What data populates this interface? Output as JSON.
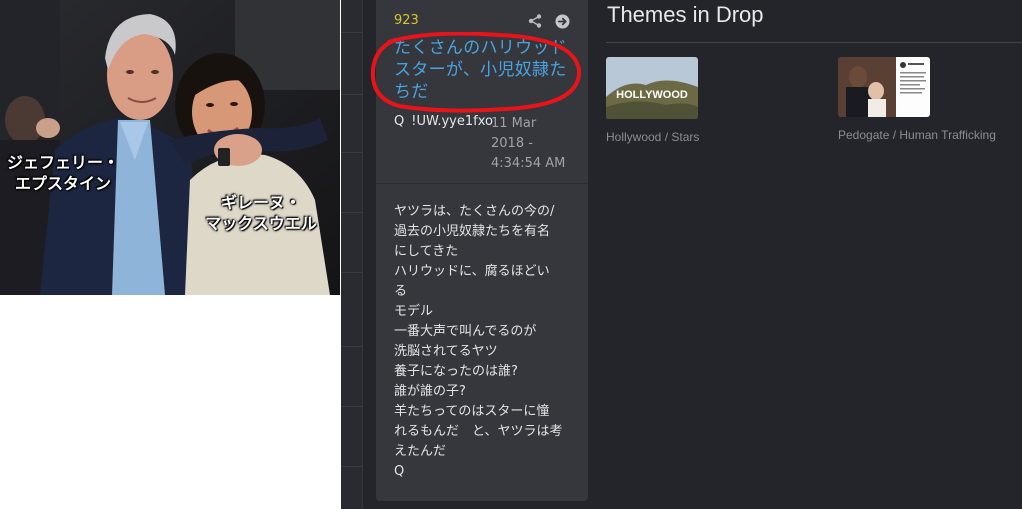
{
  "photo": {
    "caption_left": [
      "ジェフェリー・",
      "エプスタイン"
    ],
    "caption_right": [
      "ギレーヌ・",
      "マックスウエル"
    ]
  },
  "drop": {
    "number": "923",
    "title": "たくさんのハリウッドスターが、小児奴隷たちだ",
    "author_q": "Q",
    "tripcode": "!UW.yye1fxo",
    "date": "11 Mar 2018 - 4:34:54 AM",
    "body": [
      "ヤツラは、たくさんの今の/",
      "過去の小児奴隷たちを有名",
      "にしてきた",
      "ハリウッドに、腐るほどい",
      "る",
      "モデル",
      "一番大声で叫んでるのが",
      "洗脳されてるヤツ",
      "養子になったのは誰?",
      "誰が誰の子?",
      "羊たちってのはスターに憧",
      "れるもんだ　と、ヤツラは考",
      "えたんだ",
      "Q"
    ],
    "icons": [
      "share-icon",
      "arrow-right-circle-icon"
    ]
  },
  "themes": {
    "title": "Themes in Drop",
    "items": [
      {
        "label": "Hollywood / Stars",
        "thumb_text": "HOLLYWOOD"
      },
      {
        "label": "Pedogate / Human Trafficking"
      }
    ]
  },
  "colors": {
    "background": "#24252a",
    "card": "#35373d",
    "number": "#d9c52e",
    "title_link": "#4aa3df",
    "annotation_red": "#e8141a"
  }
}
